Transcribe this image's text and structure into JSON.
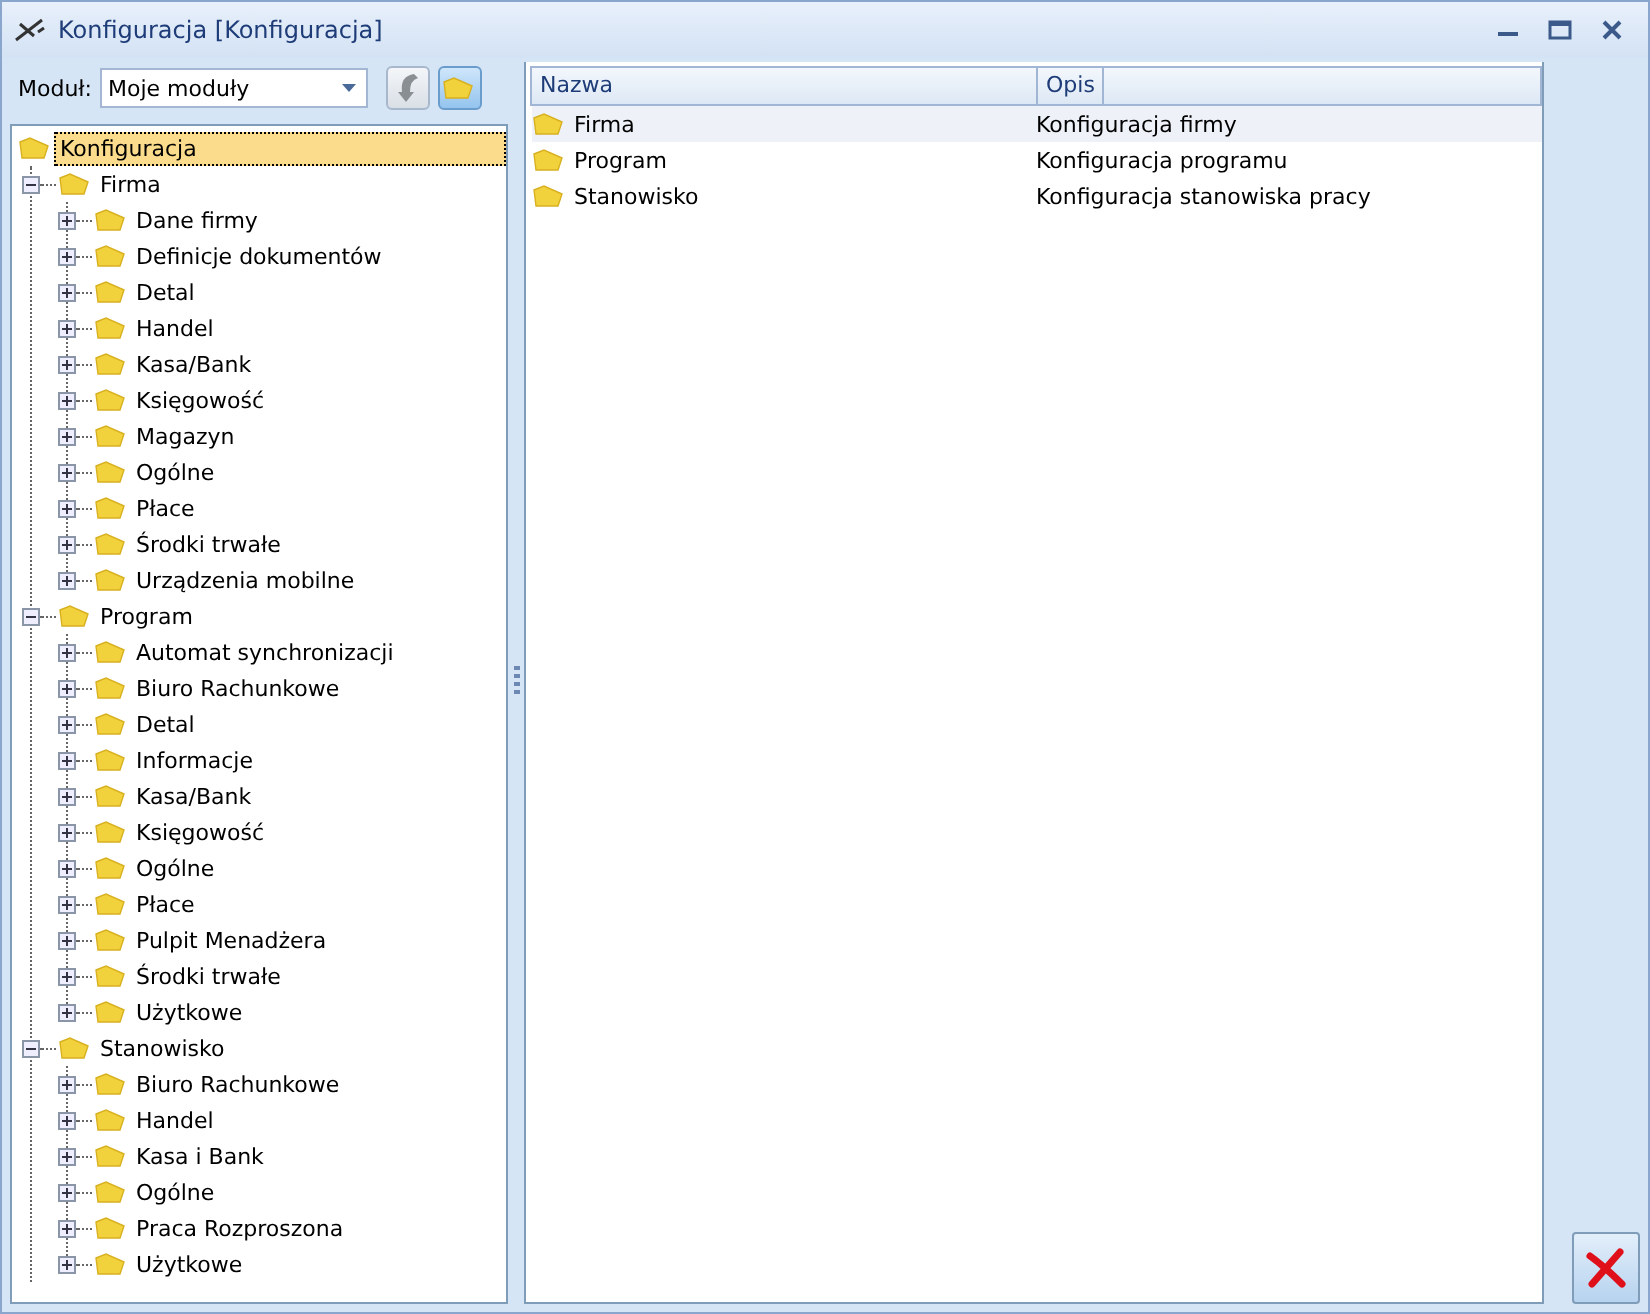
{
  "window": {
    "title": "Konfiguracja [Konfiguracja]"
  },
  "module": {
    "label": "Moduł:",
    "value": "Moje moduły"
  },
  "toolbar": [
    {
      "kind": "back",
      "selected": false
    },
    {
      "kind": "folder",
      "selected": true
    }
  ],
  "tree": [
    {
      "label": "Konfiguracja",
      "selected": true,
      "children": [
        {
          "label": "Firma",
          "selected": false,
          "expanded": true,
          "children": [
            {
              "label": "Dane firmy",
              "selected": false,
              "expanded": false
            },
            {
              "label": "Definicje dokumentów",
              "selected": false,
              "expanded": false
            },
            {
              "label": "Detal",
              "selected": false,
              "expanded": false
            },
            {
              "label": "Handel",
              "selected": false,
              "expanded": false
            },
            {
              "label": "Kasa/Bank",
              "selected": false,
              "expanded": false
            },
            {
              "label": "Księgowość",
              "selected": false,
              "expanded": false
            },
            {
              "label": "Magazyn",
              "selected": false,
              "expanded": false
            },
            {
              "label": "Ogólne",
              "selected": false,
              "expanded": false
            },
            {
              "label": "Płace",
              "selected": false,
              "expanded": false
            },
            {
              "label": "Środki trwałe",
              "selected": false,
              "expanded": false
            },
            {
              "label": "Urządzenia mobilne",
              "selected": false,
              "expanded": false
            }
          ]
        },
        {
          "label": "Program",
          "selected": false,
          "expanded": true,
          "children": [
            {
              "label": "Automat synchronizacji",
              "selected": false,
              "expanded": false
            },
            {
              "label": "Biuro Rachunkowe",
              "selected": false,
              "expanded": false
            },
            {
              "label": "Detal",
              "selected": false,
              "expanded": false
            },
            {
              "label": "Informacje",
              "selected": false,
              "expanded": false
            },
            {
              "label": "Kasa/Bank",
              "selected": false,
              "expanded": false
            },
            {
              "label": "Księgowość",
              "selected": false,
              "expanded": false
            },
            {
              "label": "Ogólne",
              "selected": false,
              "expanded": false
            },
            {
              "label": "Płace",
              "selected": false,
              "expanded": false
            },
            {
              "label": "Pulpit Menadżera",
              "selected": false,
              "expanded": false
            },
            {
              "label": "Środki trwałe",
              "selected": false,
              "expanded": false
            },
            {
              "label": "Użytkowe",
              "selected": false,
              "expanded": false
            }
          ]
        },
        {
          "label": "Stanowisko",
          "selected": false,
          "expanded": true,
          "children": [
            {
              "label": "Biuro Rachunkowe",
              "selected": false,
              "expanded": false
            },
            {
              "label": "Handel",
              "selected": false,
              "expanded": false
            },
            {
              "label": "Kasa i Bank",
              "selected": false,
              "expanded": false
            },
            {
              "label": "Ogólne",
              "selected": false,
              "expanded": false
            },
            {
              "label": "Praca Rozproszona",
              "selected": false,
              "expanded": false
            },
            {
              "label": "Użytkowe",
              "selected": false,
              "expanded": false
            }
          ]
        }
      ]
    }
  ],
  "table": {
    "columns": [
      "Nazwa",
      "Opis"
    ],
    "rows": [
      {
        "name": "Firma",
        "description": "Konfiguracja firmy",
        "selected": true
      },
      {
        "name": "Program",
        "description": "Konfiguracja programu",
        "selected": false
      },
      {
        "name": "Stanowisko",
        "description": "Konfiguracja stanowiska pracy",
        "selected": false
      }
    ]
  }
}
